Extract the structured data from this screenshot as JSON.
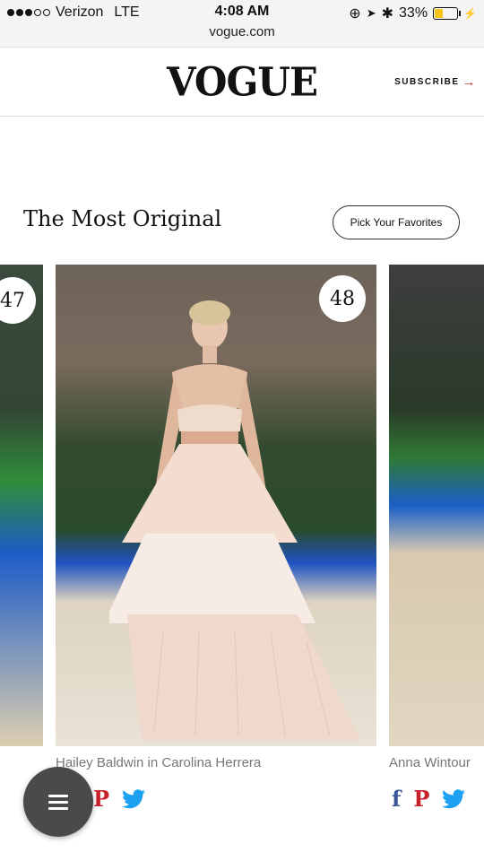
{
  "status_bar": {
    "carrier": "Verizon",
    "network": "LTE",
    "time": "4:08 AM",
    "url": "vogue.com",
    "battery": "33%",
    "battery_level": 0.33
  },
  "header": {
    "logo": "VOGUE",
    "subscribe_label": "SUBSCRIBE",
    "subscribe_arrow": "→",
    "accent_color": "#c0392b"
  },
  "gallery": {
    "title": "The Most Original",
    "pick_button": "Pick Your Favorites",
    "slides": [
      {
        "number": "47",
        "caption": ""
      },
      {
        "number": "48",
        "caption": "Hailey Baldwin in Carolina Herrera"
      },
      {
        "number": "",
        "caption": "Anna Wintour"
      }
    ]
  },
  "share": {
    "facebook": "f",
    "pinterest": "P",
    "twitter_icon": "twitter-icon"
  },
  "menu": {
    "icon": "hamburger-icon"
  }
}
